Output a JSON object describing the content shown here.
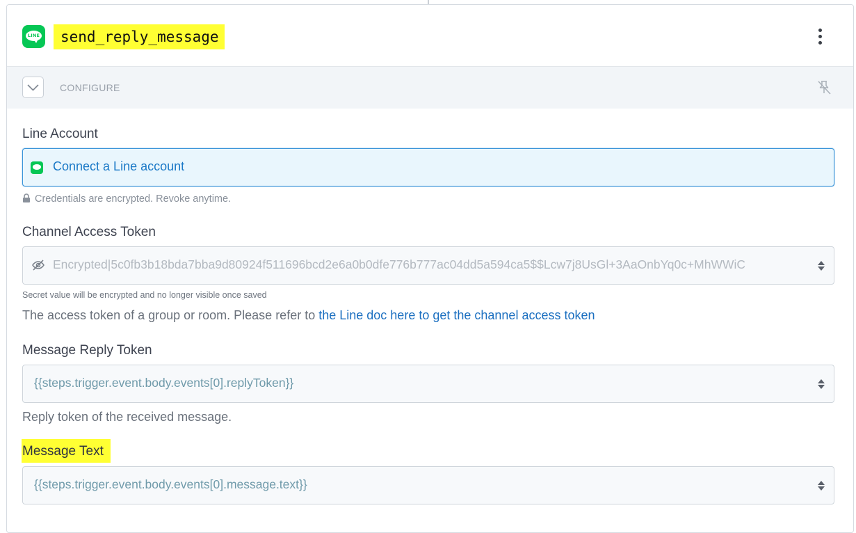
{
  "header": {
    "step_name": "send_reply_message",
    "logo_text": "LINE"
  },
  "configure": {
    "label": "CONFIGURE"
  },
  "line_account": {
    "label": "Line Account",
    "connect_label": "Connect a Line account",
    "credentials_note": "Credentials are encrypted. Revoke anytime."
  },
  "channel_access_token": {
    "label": "Channel Access Token",
    "value": "Encrypted|5c0fb3b18bda7bba9d80924f511696bcd2e6a0b0dfe776b777ac04dd5a594ca5$$Lcw7j8UsGl+3AaOnbYq0c+MhWWiC",
    "secret_note": "Secret value will be encrypted and no longer visible once saved",
    "description_prefix": "The access token of a group or room. Please refer to ",
    "description_link": "the Line doc here to get the channel access token"
  },
  "message_reply_token": {
    "label": "Message Reply Token",
    "value": "{{steps.trigger.event.body.events[0].replyToken}}",
    "description": "Reply token of the received message."
  },
  "message_text": {
    "label": "Message Text",
    "value": "{{steps.trigger.event.body.events[0].message.text}}"
  },
  "colors": {
    "line_green": "#06c755",
    "highlight": "#ffff33",
    "link_blue": "#1b6fc0"
  }
}
